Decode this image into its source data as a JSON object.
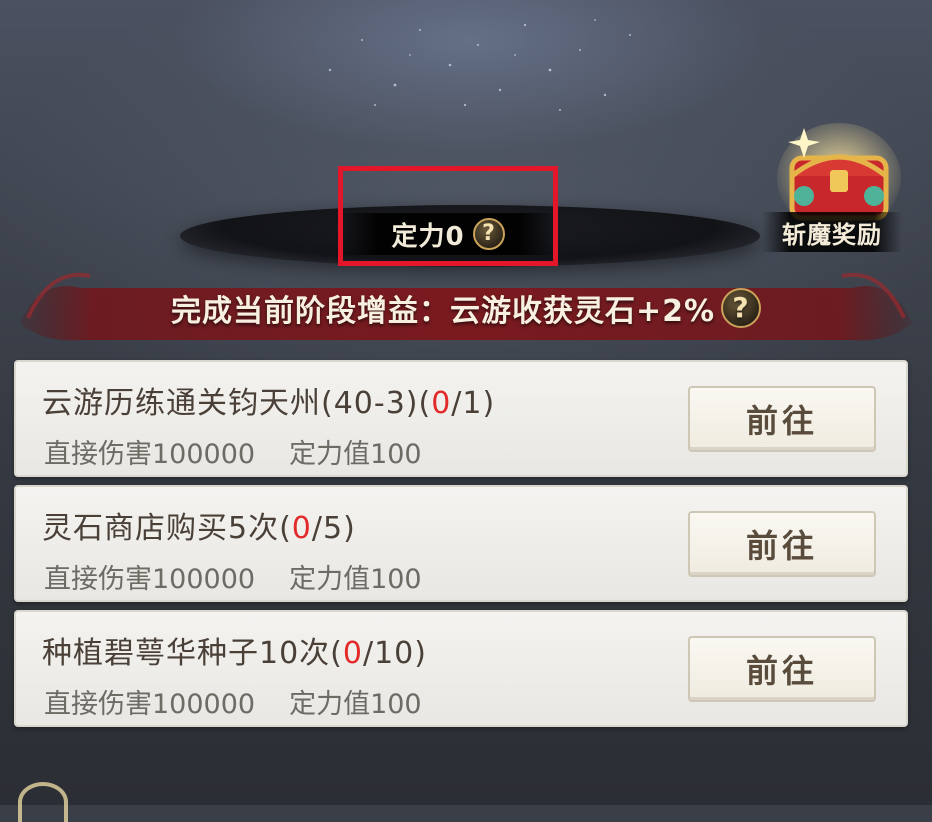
{
  "stage": {
    "dingli_label": "定力0",
    "help_glyph": "?"
  },
  "reward": {
    "label": "斩魔奖励",
    "icon": "treasure-chest-icon"
  },
  "bonus_banner": {
    "text": "完成当前阶段增益：云游收获灵石+2%",
    "help_glyph": "?"
  },
  "tasks": [
    {
      "title_prefix": "云游历练通关钧天州(40-3)(",
      "current": "0",
      "title_suffix": "/1)",
      "damage": "直接伤害100000",
      "dingli": "定力值100",
      "button": "前往"
    },
    {
      "title_prefix": "灵石商店购买5次(",
      "current": "0",
      "title_suffix": "/5)",
      "damage": "直接伤害100000",
      "dingli": "定力值100",
      "button": "前往"
    },
    {
      "title_prefix": "种植碧萼华种子10次(",
      "current": "0",
      "title_suffix": "/10)",
      "damage": "直接伤害100000",
      "dingli": "定力值100",
      "button": "前往"
    }
  ],
  "colors": {
    "highlight_box": "#e3162a",
    "progress_current": "#e22a2a",
    "banner_red": "#7a1a1f"
  }
}
